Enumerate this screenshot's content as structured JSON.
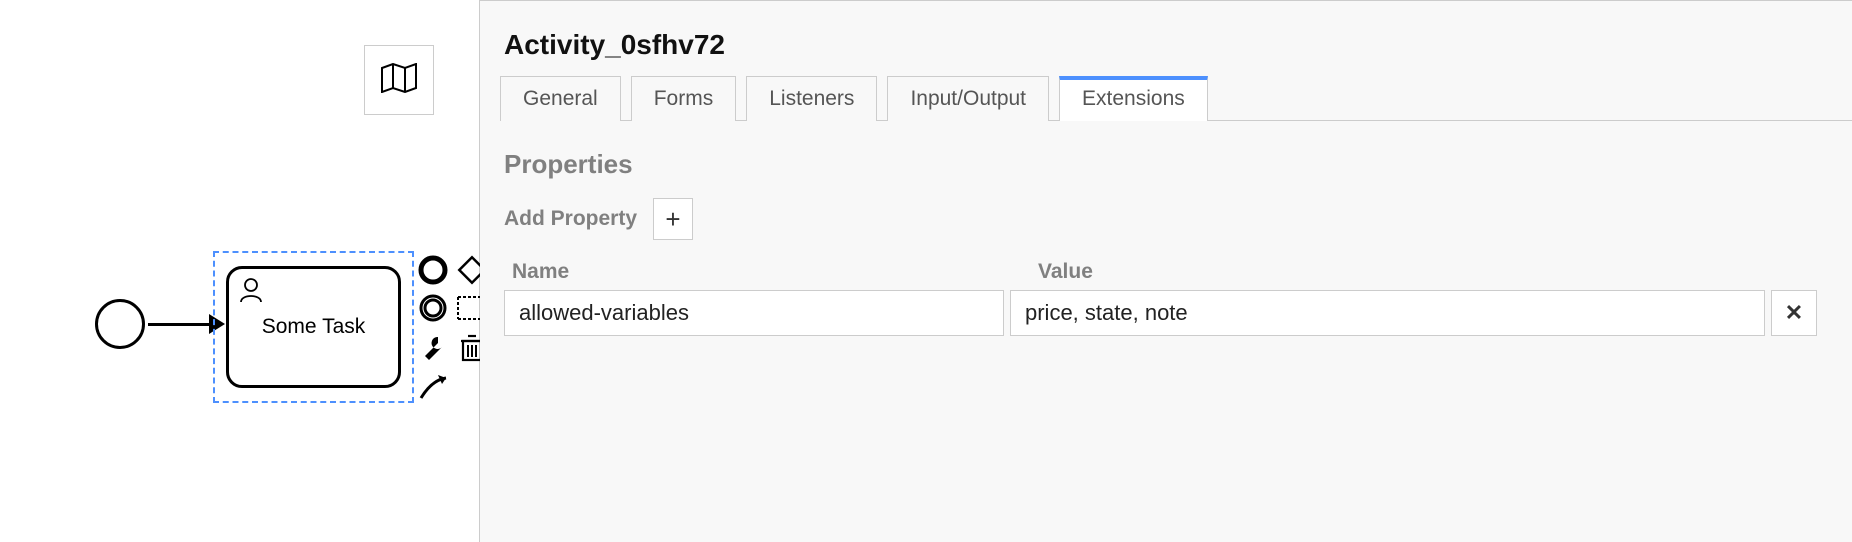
{
  "canvas": {
    "task_label": "Some Task"
  },
  "panel": {
    "header": "Activity_0sfhv72",
    "tabs": {
      "general": "General",
      "forms": "Forms",
      "listeners": "Listeners",
      "input_output": "Input/Output",
      "extensions": "Extensions"
    },
    "section_title": "Properties",
    "add_property_label": "Add Property",
    "add_property_btn": "+",
    "columns": {
      "name": "Name",
      "value": "Value"
    },
    "rows": [
      {
        "name": "allowed-variables",
        "value": "price, state, note"
      }
    ],
    "delete_btn": "✕"
  }
}
